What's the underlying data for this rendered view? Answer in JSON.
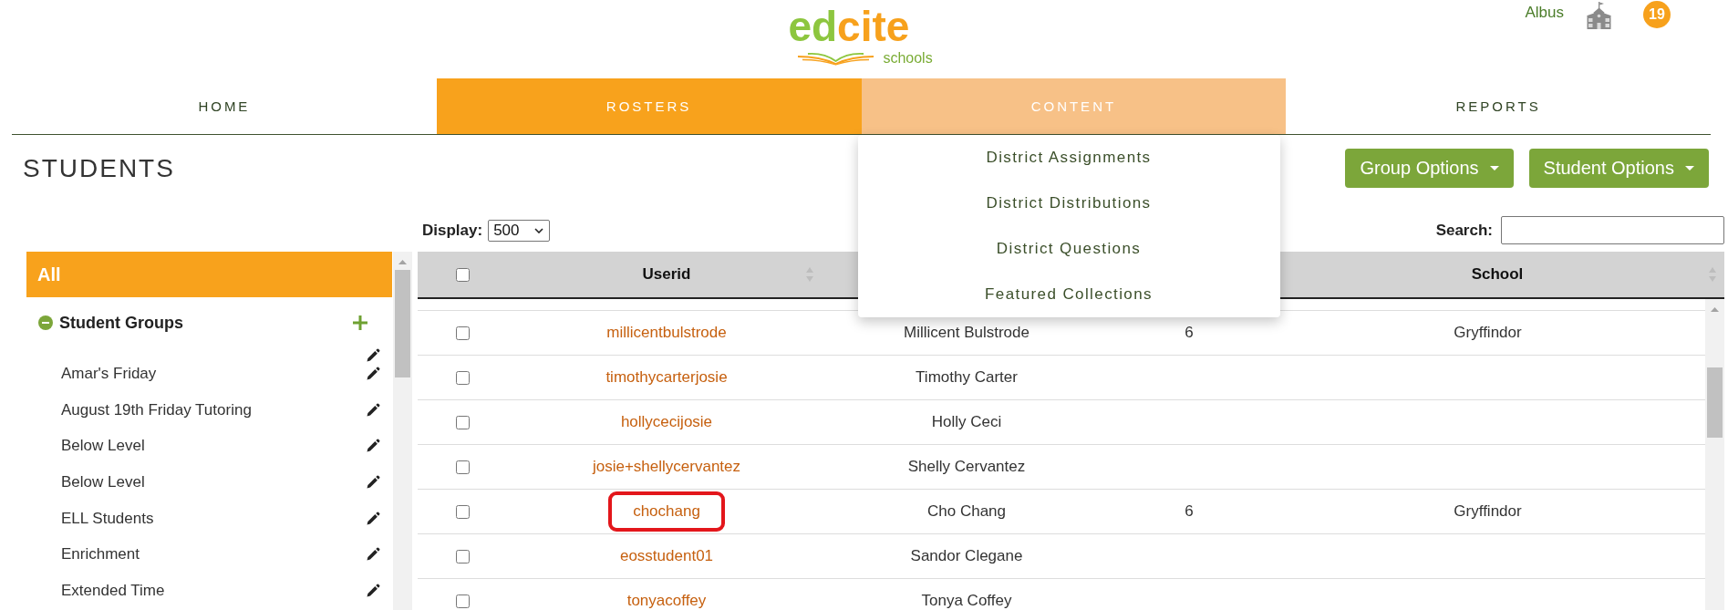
{
  "header": {
    "logo": {
      "part_1": "ed",
      "part_2": "cite",
      "tagline": "schools"
    },
    "user_name": "Albus",
    "notification_count": "19"
  },
  "nav": {
    "tabs": [
      {
        "label": "HOME",
        "selected": false,
        "expanded": false
      },
      {
        "label": "ROSTERS",
        "selected": true,
        "expanded": false
      },
      {
        "label": "CONTENT",
        "selected": false,
        "expanded": true,
        "menu": [
          {
            "label": "District Assignments"
          },
          {
            "label": "District Distributions"
          },
          {
            "label": "District Questions"
          },
          {
            "label": "Featured Collections"
          }
        ]
      },
      {
        "label": "REPORTS",
        "selected": false,
        "expanded": false
      }
    ]
  },
  "page_title": "STUDENTS",
  "buttons": [
    {
      "label": "Group Options"
    },
    {
      "label": "Student Options"
    }
  ],
  "display": {
    "label": "Display:",
    "value": "500"
  },
  "search": {
    "label": "Search:"
  },
  "sidebar": {
    "all_item": {
      "label": "All",
      "selected": true
    },
    "groups_section": {
      "title": "Student Groups",
      "expanded": true,
      "groups": [
        {
          "label": "Amar's Friday",
          "selected": false
        },
        {
          "label": "August 19th Friday Tutoring",
          "selected": false
        },
        {
          "label": "Below Level",
          "selected": false
        },
        {
          "label": "Below Level",
          "selected": false
        },
        {
          "label": "ELL Students",
          "selected": false
        },
        {
          "label": "Enrichment",
          "selected": false
        },
        {
          "label": "Extended Time",
          "selected": false
        }
      ]
    }
  },
  "table": {
    "columns": [
      {
        "kind": "checkbox",
        "checked": false,
        "sortable": false
      },
      {
        "kind": "text",
        "label": "Userid",
        "sortable": true
      },
      {
        "kind": "text",
        "sortable": false
      },
      {
        "kind": "text",
        "sortable": false
      },
      {
        "kind": "text",
        "label": "School",
        "sortable": true
      }
    ],
    "rows": [
      {
        "checked": false,
        "userid": "millicentbulstrode",
        "column_3": "Millicent Bulstrode",
        "column_4": "6",
        "school": "Gryffindor",
        "highlighted": false
      },
      {
        "checked": false,
        "userid": "timothycarterjosie",
        "column_3": "Timothy Carter",
        "highlighted": false
      },
      {
        "checked": false,
        "userid": "hollycecijosie",
        "column_3": "Holly Ceci",
        "highlighted": false
      },
      {
        "checked": false,
        "userid": "josie+shellycervantez",
        "column_3": "Shelly Cervantez",
        "highlighted": false
      },
      {
        "checked": false,
        "userid": "chochang",
        "column_3": "Cho Chang",
        "column_4": "6",
        "school": "Gryffindor",
        "highlighted": true
      },
      {
        "checked": false,
        "userid": "eosstudent01",
        "column_3": "Sandor Clegane",
        "highlighted": false
      },
      {
        "checked": false,
        "userid": "tonyacoffey",
        "column_3": "Tonya Coffey",
        "highlighted": false
      }
    ]
  }
}
